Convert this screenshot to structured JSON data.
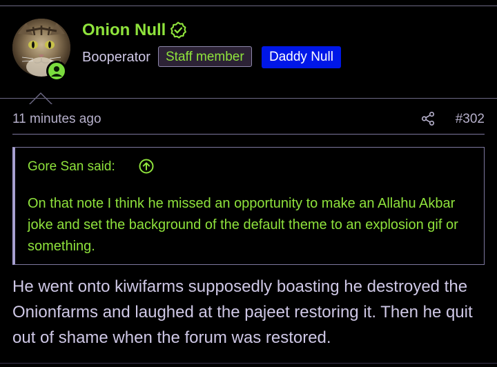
{
  "user": {
    "name": "Onion Null",
    "title": "Booperator",
    "badges": [
      "Staff member",
      "Daddy Null"
    ],
    "colors": {
      "name": "#8fe33c",
      "staff_badge_bg": "#2c2235",
      "daddy_badge_bg": "#0017e8",
      "online_dot": "#7bdc3e"
    },
    "icons": {
      "verified": "verified-check-icon",
      "online": "online-status-icon"
    }
  },
  "post": {
    "timestamp": "11 minutes ago",
    "number": "#302",
    "share_icon": "share-icon",
    "quote": {
      "attribution": "Gore San said:",
      "jump_icon": "arrow-up-circle-icon",
      "text": "On that note I think he missed an opportunity to make an Allahu Akbar joke and set the background of the default theme to an explosion gif or something."
    },
    "body": "He went onto kiwifarms supposedly boasting he destroyed the Onionfarms and laughed at the pajeet restoring it. Then he quit out of shame when the forum was restored."
  }
}
